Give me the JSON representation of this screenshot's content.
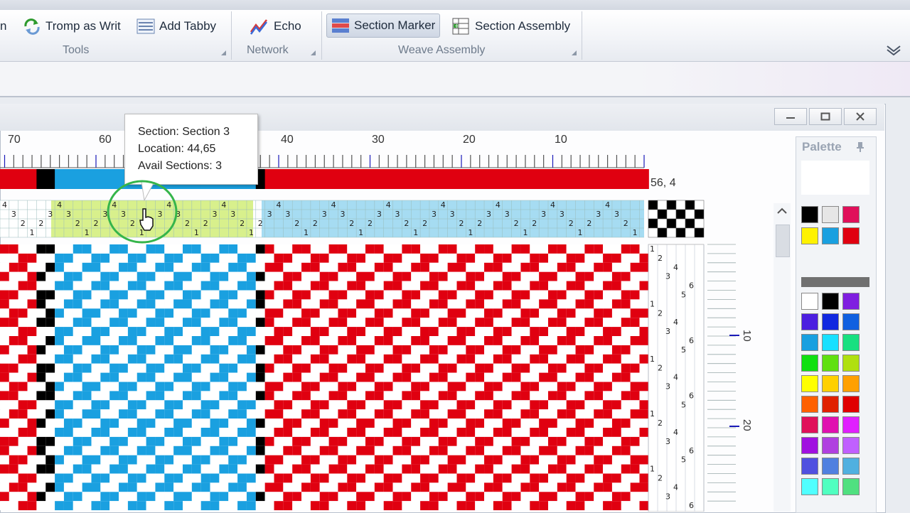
{
  "ribbon": {
    "tromp_label": "Tromp as Writ",
    "add_tabby_label": "Add Tabby",
    "echo_label": "Echo",
    "section_marker_label": "Section Marker",
    "section_assembly_label": "Section Assembly",
    "group_tools": "Tools",
    "group_network": "Network",
    "group_weave_assembly": "Weave Assembly",
    "partial_left": "n"
  },
  "ruler": {
    "top_numbers": [
      "70",
      "60",
      "40",
      "30",
      "20",
      "10"
    ],
    "side_numbers": [
      "10",
      "20"
    ]
  },
  "status": {
    "coords": "56, 4"
  },
  "tooltip": {
    "section": "Section: Section 3",
    "location": "Location: 44,65",
    "avail": "Avail Sections: 3"
  },
  "palette": {
    "title": "Palette",
    "top_colors": [
      "#000000",
      "#e6e6e6",
      "#e0105a",
      "#fff200",
      "#1aa0e0",
      "#e00010"
    ],
    "colors": [
      "#ffffff",
      "#000000",
      "#7f1ee0",
      "#4b1ee0",
      "#1028e0",
      "#1060e0",
      "#18a0e0",
      "#18e0ff",
      "#18e080",
      "#10e010",
      "#60e010",
      "#b0e010",
      "#ffff00",
      "#ffd000",
      "#ffa000",
      "#ff6000",
      "#e02000",
      "#e00000",
      "#e0105a",
      "#e010b0",
      "#e020ff",
      "#a010e0",
      "#b040e0",
      "#c060ff",
      "#5050e0",
      "#5080e0",
      "#50b0e0",
      "#50ffff",
      "#50ffc0",
      "#50e080"
    ]
  },
  "colors": {
    "red": "#e00010",
    "blue": "#1aa0e0",
    "lime": "#d8f08c",
    "lightblue": "#a6dcf2",
    "black": "#000000"
  }
}
